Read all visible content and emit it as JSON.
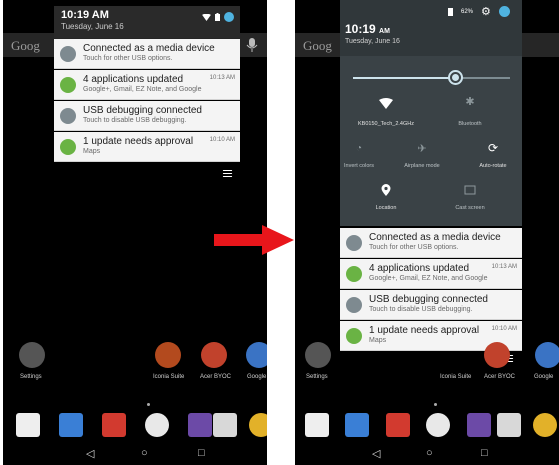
{
  "left": {
    "shade": {
      "time": "10:19 AM",
      "date": "Tuesday, June 16"
    },
    "search_text": "Goog",
    "notifications": [
      {
        "title": "Connected as a media device",
        "subtitle": "Touch for other USB options.",
        "time": "",
        "icon": "usb-icon",
        "color": "#7e8a90"
      },
      {
        "title": "4 applications updated",
        "subtitle": "Google+, Gmail, EZ Note, and Google",
        "time": "10:13 AM",
        "icon": "play-store-icon",
        "color": "#6ab344"
      },
      {
        "title": "USB debugging connected",
        "subtitle": "Touch to disable USB debugging.",
        "time": "",
        "icon": "debug-icon",
        "color": "#7e8a90"
      },
      {
        "title": "1 update needs approval",
        "subtitle": "Maps",
        "time": "10:10 AM",
        "icon": "play-store-icon",
        "color": "#6ab344"
      }
    ],
    "apps": [
      {
        "label": "Settings"
      },
      {
        "label": "Iconia Suite"
      },
      {
        "label": "Acer BYOC"
      },
      {
        "label": "Google"
      }
    ]
  },
  "right": {
    "search_text": "Goog",
    "qs": {
      "time": "10:19",
      "ampm": "AM",
      "date": "Tuesday, June 16",
      "battery": "62%",
      "tiles": [
        {
          "label": "KB0150_Tech_2.4GHz",
          "icon": "wifi-icon",
          "active": true
        },
        {
          "label": "Bluetooth",
          "icon": "bluetooth-icon",
          "active": false
        },
        {
          "label": "Invert colors",
          "icon": "invert-colors-icon",
          "active": false
        },
        {
          "label": "Airplane mode",
          "icon": "airplane-icon",
          "active": false
        },
        {
          "label": "Auto-rotate",
          "icon": "auto-rotate-icon",
          "active": true
        },
        {
          "label": "Location",
          "icon": "location-icon",
          "active": true
        },
        {
          "label": "Cast screen",
          "icon": "cast-icon",
          "active": false
        }
      ]
    },
    "notifications": [
      {
        "title": "Connected as a media device",
        "subtitle": "Touch for other USB options.",
        "time": "",
        "icon": "usb-icon",
        "color": "#7e8a90"
      },
      {
        "title": "4 applications updated",
        "subtitle": "Google+, Gmail, EZ Note, and Google",
        "time": "10:13 AM",
        "icon": "play-store-icon",
        "color": "#6ab344"
      },
      {
        "title": "USB debugging connected",
        "subtitle": "Touch to disable USB debugging.",
        "time": "",
        "icon": "debug-icon",
        "color": "#7e8a90"
      },
      {
        "title": "1 update needs approval",
        "subtitle": "Maps",
        "time": "10:10 AM",
        "icon": "play-store-icon",
        "color": "#6ab344"
      }
    ],
    "apps": [
      {
        "label": "Settings"
      },
      {
        "label": "Iconia Suite"
      },
      {
        "label": "Acer BYOC"
      },
      {
        "label": "Google"
      }
    ]
  },
  "arrow_color": "#e8161b"
}
